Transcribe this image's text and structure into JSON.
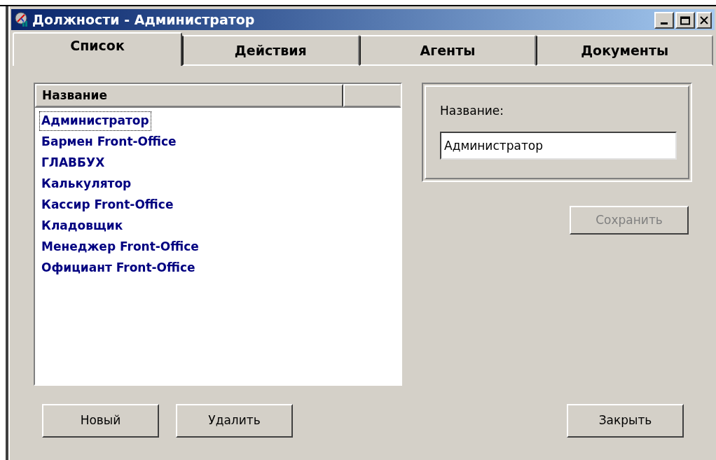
{
  "window": {
    "title": "Должности - Администратор"
  },
  "tabs": [
    {
      "label": "Список",
      "selected": true
    },
    {
      "label": "Действия",
      "selected": false
    },
    {
      "label": "Агенты",
      "selected": false
    },
    {
      "label": "Документы",
      "selected": false
    }
  ],
  "list": {
    "columns": [
      "Название"
    ],
    "items": [
      {
        "label": "Администратор",
        "selected": true
      },
      {
        "label": "Бармен Front-Office",
        "selected": false
      },
      {
        "label": "ГЛАВБУХ",
        "selected": false
      },
      {
        "label": "Калькулятор",
        "selected": false
      },
      {
        "label": "Кассир Front-Office",
        "selected": false
      },
      {
        "label": "Кладовщик",
        "selected": false
      },
      {
        "label": "Менеджер Front-Office",
        "selected": false
      },
      {
        "label": "Официант Front-Office",
        "selected": false
      }
    ]
  },
  "form": {
    "label": "Название:",
    "value": "Администратор"
  },
  "save_button": {
    "label": "Сохранить",
    "disabled": true
  },
  "buttons": [
    {
      "label": "Новый",
      "kind": "left"
    },
    {
      "label": "Удалить",
      "kind": "left"
    },
    {
      "label": "Закрыть",
      "kind": "right"
    }
  ]
}
